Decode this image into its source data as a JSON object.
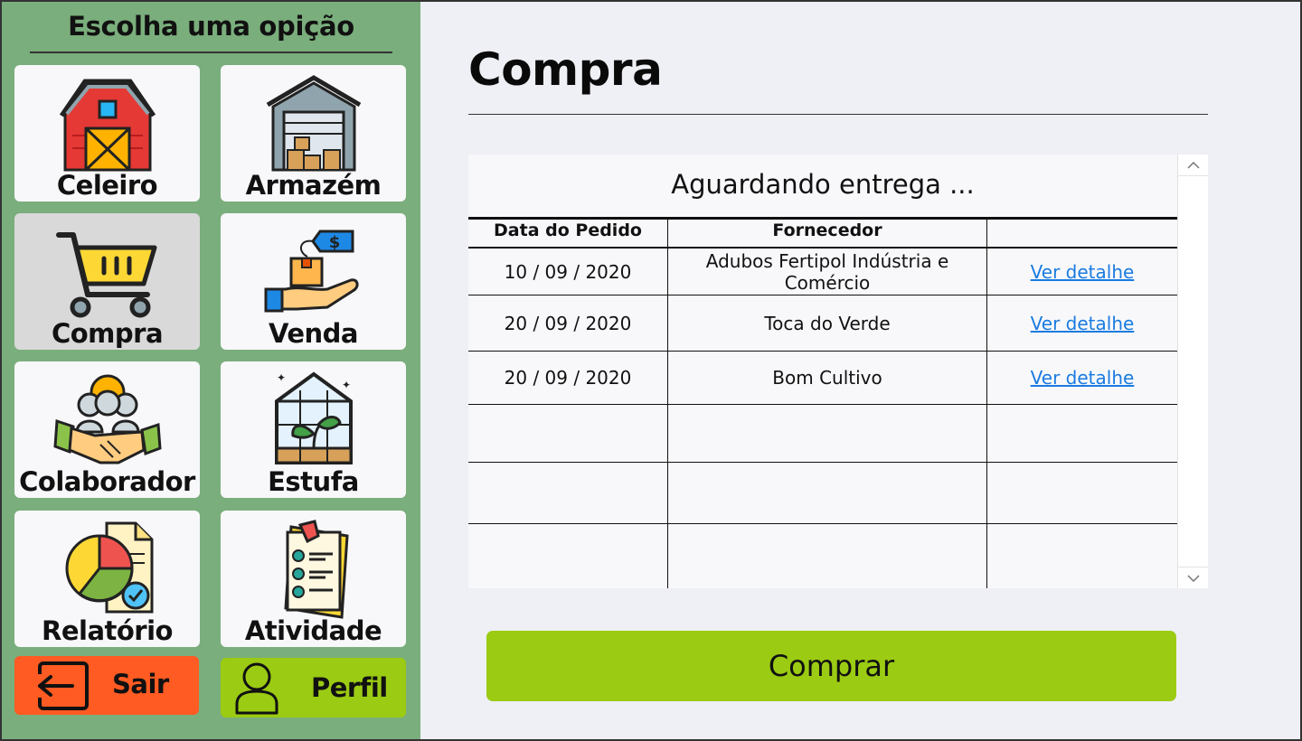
{
  "sidebar": {
    "title": "Escolha uma opição",
    "tiles": [
      {
        "label": "Celeiro",
        "icon": "barn-icon"
      },
      {
        "label": "Armazém",
        "icon": "warehouse-icon"
      },
      {
        "label": "Compra",
        "icon": "shopping-cart-icon",
        "active": true
      },
      {
        "label": "Venda",
        "icon": "hand-box-price-tag-icon"
      },
      {
        "label": "Colaborador",
        "icon": "handshake-team-icon"
      },
      {
        "label": "Estufa",
        "icon": "greenhouse-icon"
      },
      {
        "label": "Relatório",
        "icon": "pie-chart-report-icon"
      },
      {
        "label": "Atividade",
        "icon": "checklist-clipboard-icon"
      }
    ],
    "exit_label": "Sair",
    "profile_label": "Perfil"
  },
  "main": {
    "title": "Compra",
    "panel_title": "Aguardando entrega ...",
    "columns": [
      "Data do Pedido",
      "Fornecedor",
      ""
    ],
    "rows": [
      {
        "date": "10 / 09 / 2020",
        "supplier_line1": "Adubos Fertipol Indústria e",
        "supplier_line2": "Comércio",
        "action": "Ver detalhe"
      },
      {
        "date": "20 / 09 / 2020",
        "supplier_line1": "Toca do Verde",
        "supplier_line2": "",
        "action": "Ver detalhe"
      },
      {
        "date": "20 / 09 / 2020",
        "supplier_line1": "Bom Cultivo",
        "supplier_line2": "",
        "action": "Ver detalhe"
      }
    ],
    "buy_button": "Comprar"
  },
  "colors": {
    "sidebar_bg": "#7aae7c",
    "main_bg": "#eff0f5",
    "tile_bg": "#f8f8fb",
    "tile_active_bg": "#d9d9d9",
    "exit_bg": "#ff5b22",
    "accent_green": "#9bcb13",
    "link": "#1a7be0"
  }
}
